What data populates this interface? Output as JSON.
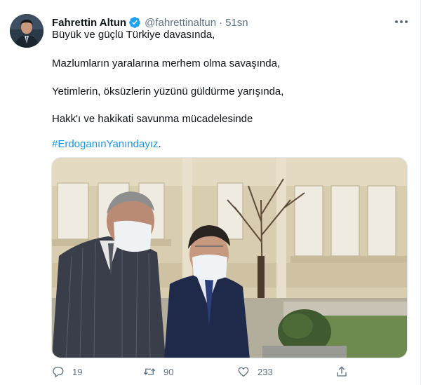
{
  "author": {
    "name": "Fahrettin Altun",
    "handle": "@fahrettinaltun",
    "separator": "·",
    "time": "51sn"
  },
  "tweet": {
    "lines": [
      "Büyük ve güçlü Türkiye davasında,",
      "Mazlumların yaralarına merhem olma savaşında,",
      "Yetimlerin, öksüzlerin yüzünü güldürme yarışında,",
      "Hakk'ı ve hakikati savunma mücadelesinde"
    ],
    "hashtag": "#ErdoganınYanındayız",
    "hashtag_suffix": "."
  },
  "actions": {
    "reply_count": "19",
    "retweet_count": "90",
    "like_count": "233"
  },
  "colors": {
    "accent": "#1b95e0",
    "muted": "#5b7083",
    "text": "#0f1419"
  },
  "icons": [
    "verified-badge-icon",
    "more-icon",
    "reply-icon",
    "retweet-icon",
    "like-icon",
    "share-icon"
  ]
}
